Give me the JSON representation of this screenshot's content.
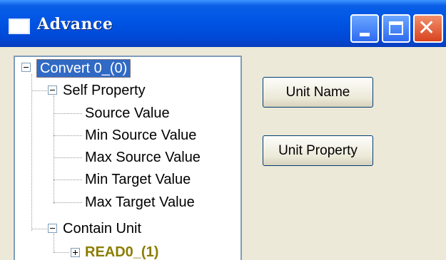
{
  "window": {
    "title": "Advance",
    "icon": "app-window-icon"
  },
  "titlebar_buttons": {
    "minimize_icon": "minimize-icon",
    "maximize_icon": "maximize-icon",
    "close_icon": "close-icon",
    "close_glyph": "✕"
  },
  "tree": {
    "root": "Convert 0_(0)",
    "self_property": "Self Property",
    "self_property_items": [
      "Source Value",
      "Min Source Value",
      "Max Source Value",
      "Min Target Value",
      "Max Target Value"
    ],
    "contain_unit": "Contain Unit",
    "contain_unit_items": [
      "READ0_(1)"
    ]
  },
  "buttons": {
    "unit_name": "Unit Name",
    "unit_property": "Unit Property"
  },
  "colors": {
    "titlebar": "#0055e5",
    "selection": "#316ac5",
    "unit_highlight": "#8b7d00"
  }
}
